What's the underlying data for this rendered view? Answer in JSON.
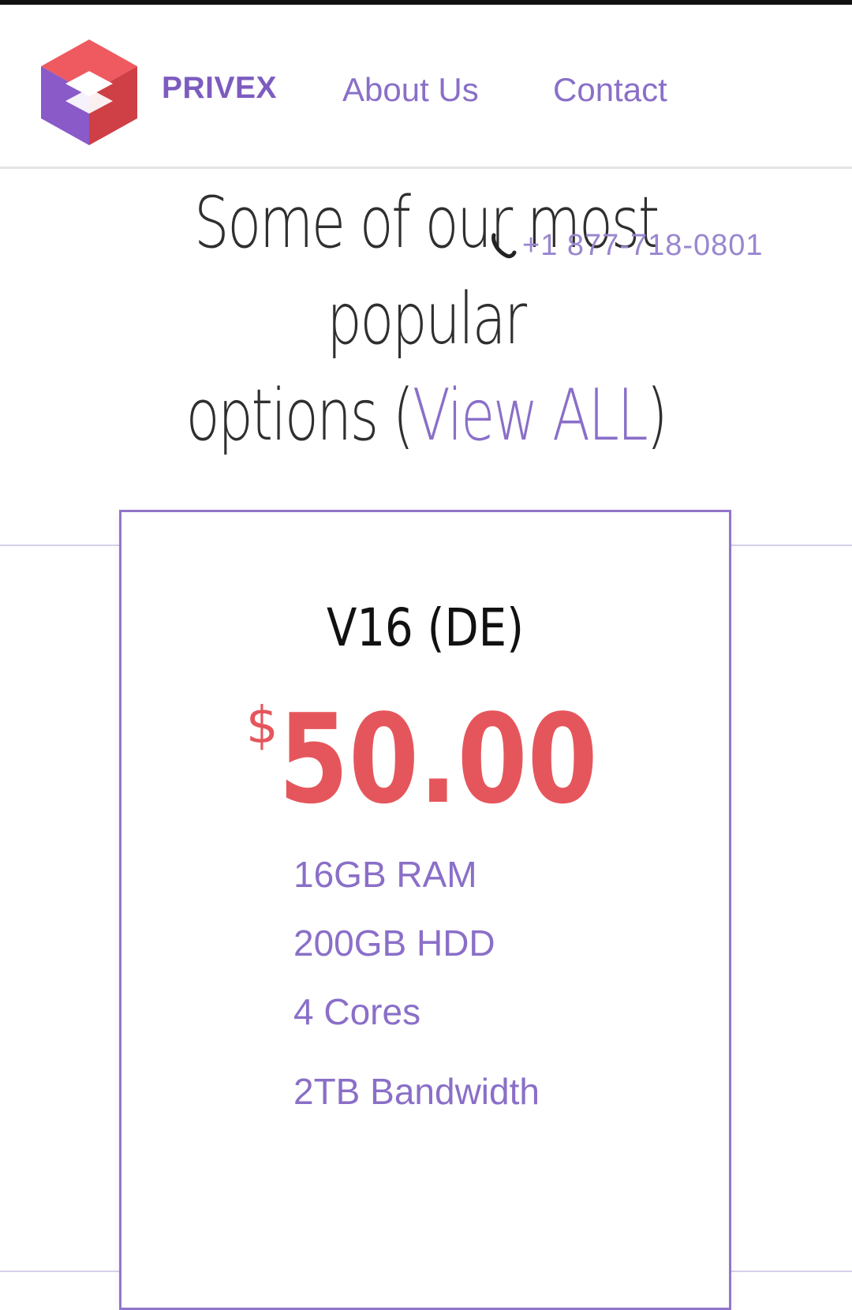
{
  "header": {
    "brand": "PRIVEX",
    "nav": [
      {
        "label": "About Us"
      },
      {
        "label": "Contact"
      }
    ],
    "phone": "+1 877-718-0801"
  },
  "hero": {
    "line1": "Some of our most popular",
    "line2_prefix": "options (",
    "view_all": "View ALL",
    "line2_suffix": ")"
  },
  "plan": {
    "name": "V16 (DE)",
    "currency": "$",
    "price": "50.00",
    "features": [
      "16GB RAM",
      "200GB HDD",
      "4 Cores",
      "2TB Bandwidth"
    ]
  },
  "colors": {
    "accent": "#8a6fc8",
    "price": "#e5565c",
    "logo_red": "#e24f55",
    "logo_purple": "#8a5ac8"
  }
}
